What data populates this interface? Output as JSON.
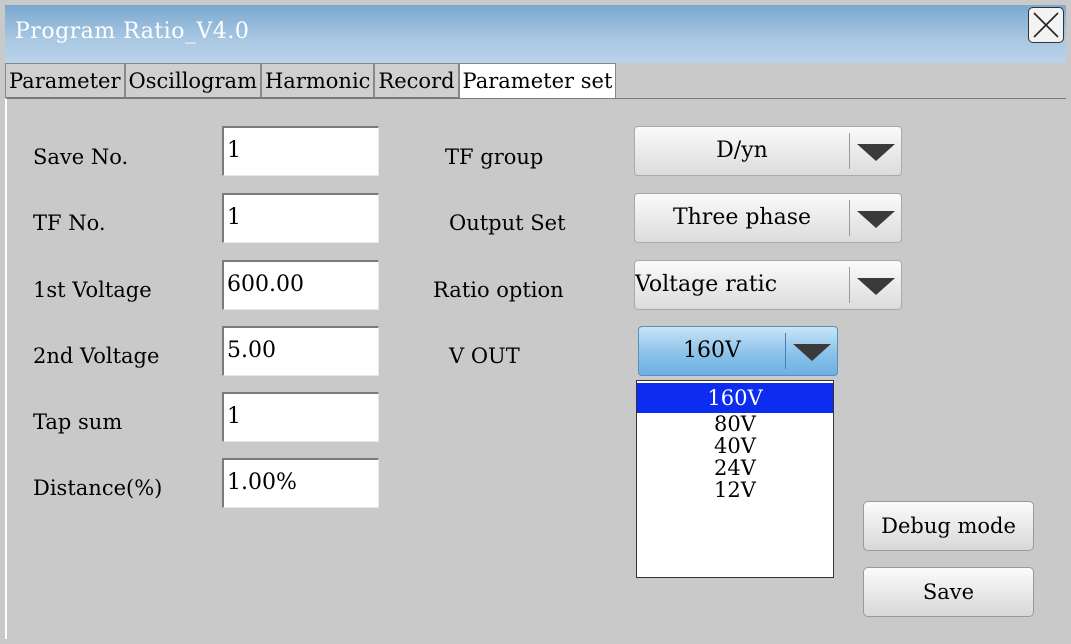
{
  "window": {
    "title": "Program Ratio_V4.0",
    "close_icon": "close-icon"
  },
  "tabs": [
    {
      "label": "Parameter",
      "active": false
    },
    {
      "label": "Oscillogram",
      "active": false
    },
    {
      "label": "Harmonic",
      "active": false
    },
    {
      "label": "Record",
      "active": false
    },
    {
      "label": "Parameter set",
      "active": true
    }
  ],
  "left_fields": {
    "save_no": {
      "label": "Save No.",
      "value": "1"
    },
    "tf_no": {
      "label": "TF No.",
      "value": "1"
    },
    "first_voltage": {
      "label": "1st Voltage",
      "value": "600.00"
    },
    "second_voltage": {
      "label": "2nd Voltage",
      "value": "5.00"
    },
    "tap_sum": {
      "label": "Tap sum",
      "value": "1"
    },
    "distance": {
      "label": "Distance(%)",
      "value": "1.00%"
    }
  },
  "right_fields": {
    "tf_group": {
      "label": "TF group",
      "value": "D/yn"
    },
    "output_set": {
      "label": "Output Set",
      "value": "Three phase"
    },
    "ratio_option": {
      "label": "Ratio option",
      "value": "Voltage ratic"
    },
    "v_out": {
      "label": "V OUT",
      "value": "160V",
      "options": [
        "160V",
        "80V",
        "40V",
        "24V",
        "12V"
      ],
      "selected": "160V"
    }
  },
  "buttons": {
    "debug_mode": "Debug mode",
    "save": "Save"
  },
  "colors": {
    "titlebar": "#8db4d8",
    "window_bg": "#c9c9c9",
    "selected_option": "#0c2cf0",
    "v_out_combo": "#8bc2ea"
  }
}
